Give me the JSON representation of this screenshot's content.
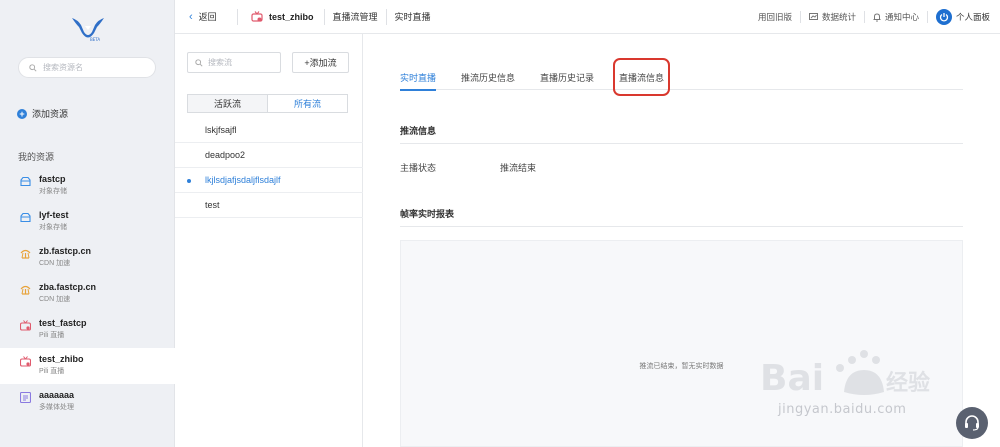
{
  "sidebar": {
    "search_placeholder": "搜索资源名",
    "add_resource": "添加资源",
    "my_resources": "我的资源",
    "items": [
      {
        "name": "fastcp",
        "type": "对象存储",
        "icon": "storage-icon",
        "color": "#3a8ee6"
      },
      {
        "name": "lyf-test",
        "type": "对象存储",
        "icon": "storage-icon",
        "color": "#3a8ee6"
      },
      {
        "name": "zb.fastcp.cn",
        "type": "CDN 加速",
        "icon": "cdn-icon",
        "color": "#e8a33a"
      },
      {
        "name": "zba.fastcp.cn",
        "type": "CDN 加速",
        "icon": "cdn-icon",
        "color": "#e8a33a"
      },
      {
        "name": "test_fastcp",
        "type": "Pili 直播",
        "icon": "live-icon",
        "color": "#e05a6d"
      },
      {
        "name": "test_zhibo",
        "type": "Pili 直播",
        "icon": "live-icon",
        "color": "#e05a6d",
        "active": true
      },
      {
        "name": "aaaaaaa",
        "type": "多媒体处理",
        "icon": "media-icon",
        "color": "#8a7ae0"
      }
    ]
  },
  "topbar": {
    "back": "返回",
    "title": "test_zhibo",
    "links": [
      "直播流管理",
      "实时直播"
    ],
    "right": {
      "old_version": "用回旧版",
      "stats": "数据统计",
      "notifications": "通知中心",
      "profile": "个人面板"
    }
  },
  "streams": {
    "search_placeholder": "搜索流",
    "add_button": "+添加流",
    "tabs": [
      "活跃流",
      "所有流"
    ],
    "active_tab": 1,
    "items": [
      "lskjfsajfl",
      "deadpoo2",
      "lkjlsdjafjsdaljflsdajlf",
      "test"
    ],
    "selected_index": 2
  },
  "main": {
    "tabs": [
      "实时直播",
      "推流历史信息",
      "直播历史记录",
      "直播流信息"
    ],
    "active_tab": 0,
    "highlighted_tab": 3,
    "push_info_title": "推流信息",
    "status_label": "主播状态",
    "status_value": "推流结束",
    "report_title": "帧率实时报表",
    "report_empty": "推流已结束，暂无实时数据"
  },
  "watermark": {
    "text": "jingyan.baidu.com",
    "logo_text": "Bai du 经验"
  }
}
